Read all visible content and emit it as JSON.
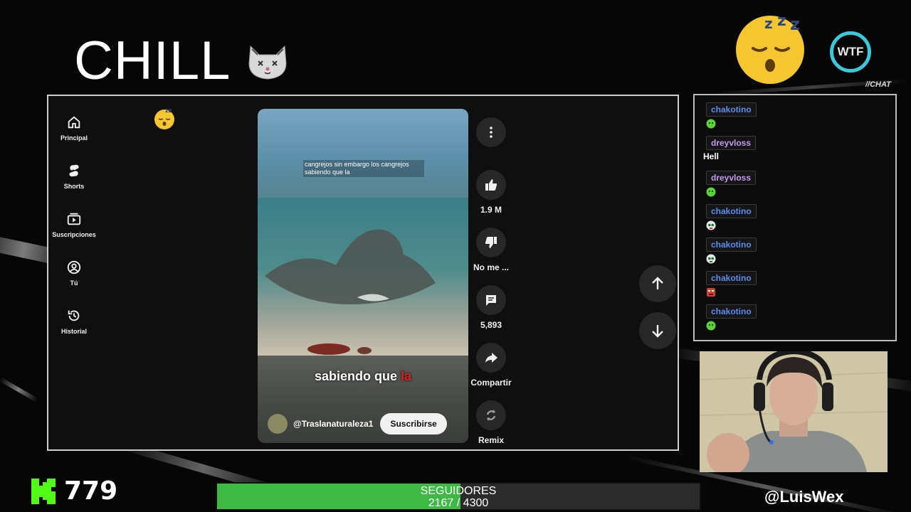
{
  "overlay": {
    "title": "CHILL",
    "wtf_badge": "WTF",
    "chat_tag": "//CHAT",
    "kick_count": "779",
    "goal_label": "SEGUIDORES",
    "goal_current": "2167",
    "goal_separator": " / ",
    "goal_target": "4300",
    "goal_progress": 0.504,
    "handle": "@LuisWex",
    "accent_green": "#3fb845",
    "wtf_ring_color": "#3cc8d8"
  },
  "youtube": {
    "nav": [
      {
        "label": "Principal",
        "icon": "home-icon"
      },
      {
        "label": "Shorts",
        "icon": "shorts-icon"
      },
      {
        "label": "Suscripciones",
        "icon": "subscriptions-icon"
      },
      {
        "label": "Tú",
        "icon": "account-icon"
      },
      {
        "label": "Historial",
        "icon": "history-icon"
      }
    ],
    "video": {
      "caption_top": "cangrejos sin embargo los cangrejos sabiendo que la",
      "caption_main": "sabiendo que",
      "caption_highlight": "la",
      "channel": "@Traslanaturaleza1",
      "subscribe": "Suscribirse"
    },
    "actions": {
      "like_count": "1.9 M",
      "dislike_label": "No me ...",
      "comments_count": "5,893",
      "share_label": "Compartir",
      "remix_label": "Remix"
    }
  },
  "chat": {
    "messages": [
      {
        "user": "chakotino",
        "color": "blue",
        "text": "",
        "emote": "green-blob-emote"
      },
      {
        "user": "dreyvloss",
        "color": "purple",
        "text": "Hell",
        "emote": ""
      },
      {
        "user": "dreyvloss",
        "color": "purple",
        "text": "",
        "emote": "green-blob-emote"
      },
      {
        "user": "chakotino",
        "color": "blue",
        "text": "",
        "emote": "skull-emote"
      },
      {
        "user": "chakotino",
        "color": "blue",
        "text": "",
        "emote": "skull-emote"
      },
      {
        "user": "chakotino",
        "color": "blue",
        "text": "",
        "emote": "angry-emote"
      },
      {
        "user": "chakotino",
        "color": "blue",
        "text": "",
        "emote": "green-blob-emote"
      }
    ]
  }
}
